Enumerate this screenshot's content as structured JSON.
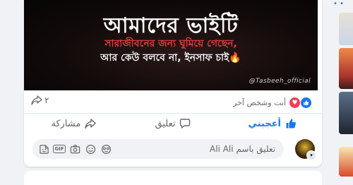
{
  "post": {
    "image": {
      "line1": "আমাদের ভাইটি",
      "line2": "সারাজীবনের জন্য ঘুমিয়ে গেছেন,",
      "line3": "আর কেউ বলবে না, ইনসাফ চাই",
      "flame": "🔥",
      "watermark": "@Tasbeeh_official"
    },
    "reactions_text": "أنت وشخص آخر",
    "shares_count": "٢",
    "actions": {
      "like_label": "أعجبني",
      "comment_label": "تعليق",
      "share_label": "مشاركة"
    },
    "comment_placeholder": "تعليق باسم Ali Ali"
  },
  "colors": {
    "accent": "#1877f2",
    "love": "#f33e58",
    "muted": "#65676b"
  },
  "icons": [
    "share-arrow-icon",
    "love-reaction-icon",
    "like-reaction-icon",
    "thumbs-up-icon",
    "comment-bubble-icon",
    "share-icon",
    "sticker-icon",
    "gif-icon",
    "camera-icon",
    "emoji-icon",
    "avatar-sticker-icon"
  ]
}
